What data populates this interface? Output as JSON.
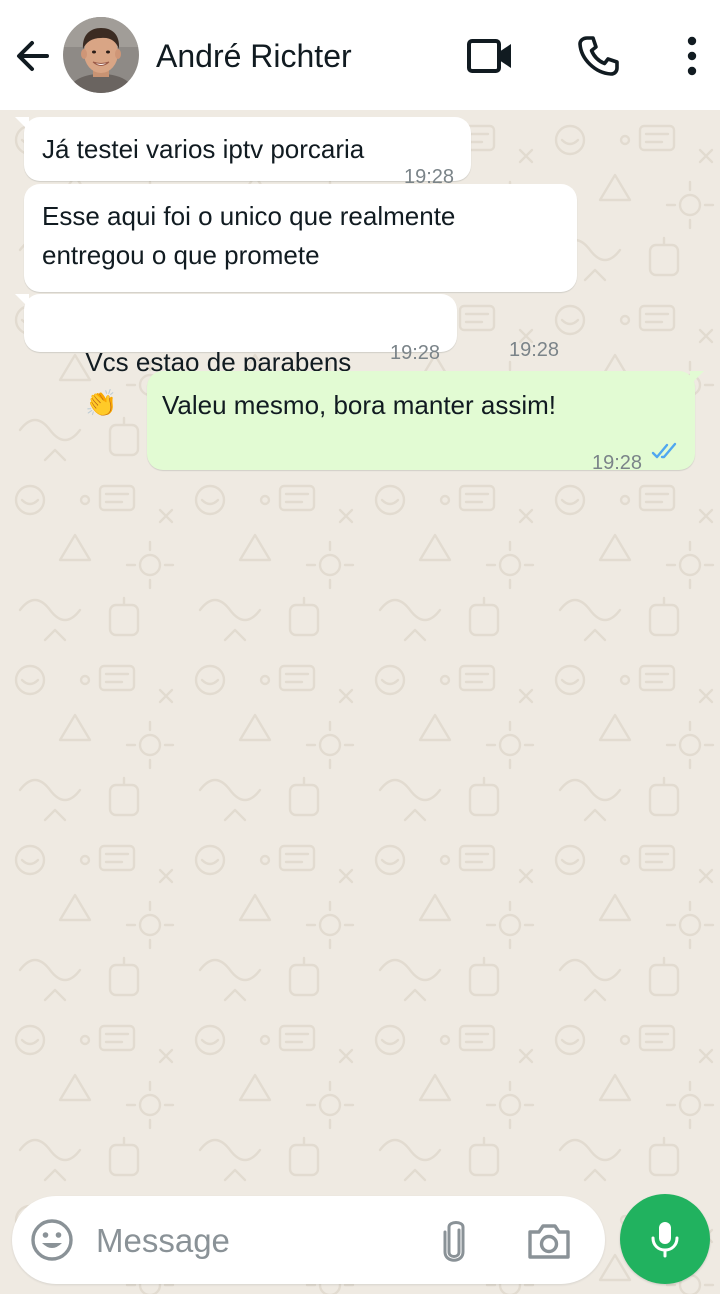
{
  "header": {
    "contact_name": "André Richter",
    "icons": {
      "back": "arrow-back-icon",
      "video": "video-camera-icon",
      "call": "phone-icon",
      "menu": "more-vertical-icon"
    }
  },
  "messages": [
    {
      "direction": "incoming",
      "text": "Já testei varios iptv porcaria",
      "time": "19:28"
    },
    {
      "direction": "incoming",
      "text_line1": "Esse aqui foi o unico que realmente",
      "text_line2": "entregou o que promete",
      "time": "19:28"
    },
    {
      "direction": "incoming",
      "text": "Vcs estao de parabens",
      "emoji": "👏",
      "time": "19:28"
    },
    {
      "direction": "outgoing",
      "text": "Valeu mesmo, bora manter assim!",
      "time": "19:28",
      "status": "read-double-check-icon"
    }
  ],
  "composer": {
    "placeholder": "Message",
    "value": "",
    "icons": {
      "emoji": "emoji-smiley-icon",
      "attach": "paperclip-icon",
      "camera": "camera-icon",
      "mic": "microphone-icon"
    }
  },
  "colors": {
    "header_bg": "#ffffff",
    "chat_bg": "#efeae2",
    "incoming_bubble": "#ffffff",
    "outgoing_bubble": "#e2fbd3",
    "accent_green": "#21b25f",
    "read_ticks": "#4fa7f0",
    "timestamp": "#7b8489"
  }
}
